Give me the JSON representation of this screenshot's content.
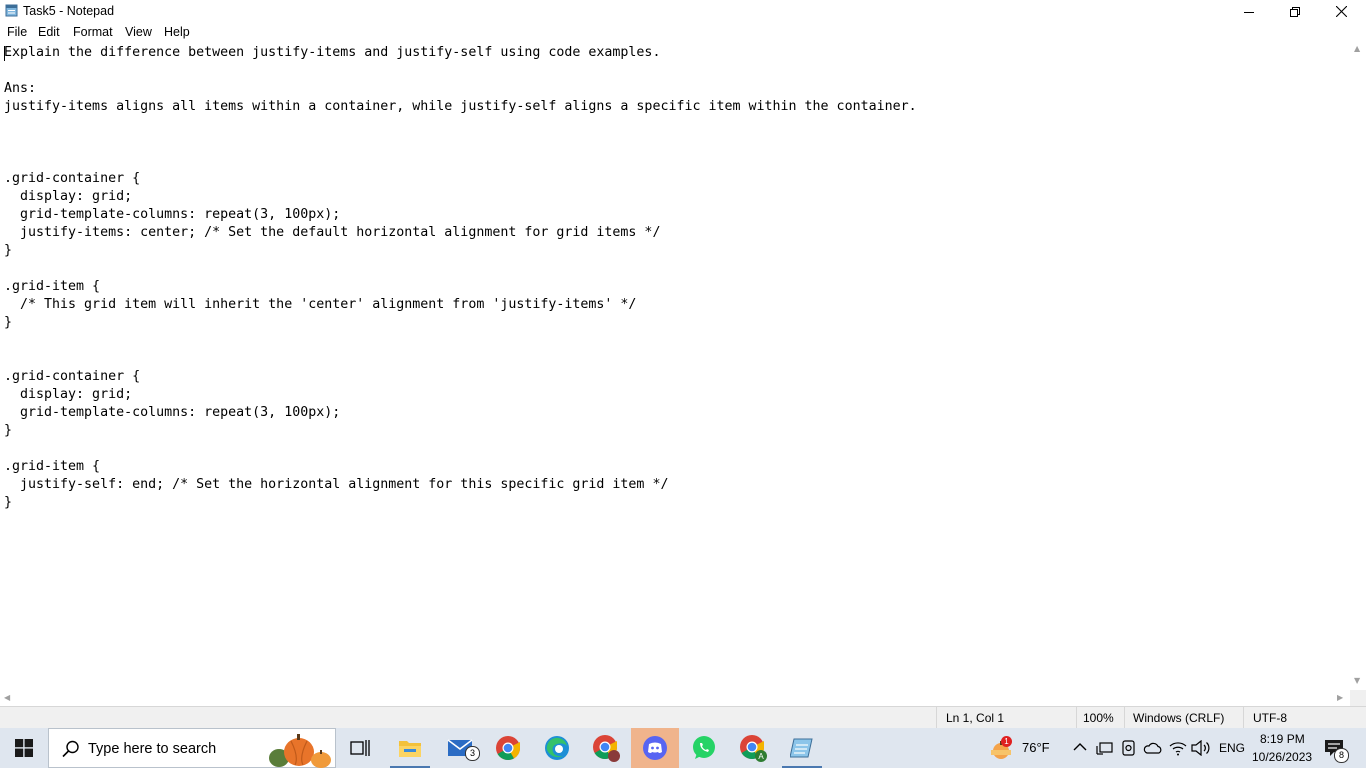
{
  "window": {
    "title": "Task5 - Notepad",
    "icon": "notepad-icon",
    "controls": {
      "minimize": "minimize-icon",
      "maximize": "restore-icon",
      "close": "close-icon"
    }
  },
  "menu": {
    "file": "File",
    "edit": "Edit",
    "format": "Format",
    "view": "View",
    "help": "Help"
  },
  "editor": {
    "content": "Explain the difference between justify-items and justify-self using code examples.\n\nAns:\njustify-items aligns all items within a container, while justify-self aligns a specific item within the container.\n\n\n\n.grid-container {\n  display: grid;\n  grid-template-columns: repeat(3, 100px);\n  justify-items: center; /* Set the default horizontal alignment for grid items */\n}\n\n.grid-item {\n  /* This grid item will inherit the 'center' alignment from 'justify-items' */\n}\n\n\n.grid-container {\n  display: grid;\n  grid-template-columns: repeat(3, 100px);\n}\n\n.grid-item {\n  justify-self: end; /* Set the horizontal alignment for this specific grid item */\n}"
  },
  "statusbar": {
    "position": "Ln 1, Col 1",
    "zoom": "100%",
    "line_ending": "Windows (CRLF)",
    "encoding": "UTF-8"
  },
  "taskbar": {
    "search_placeholder": "Type here to search",
    "apps": [
      {
        "name": "task-view-icon"
      },
      {
        "name": "file-explorer-icon"
      },
      {
        "name": "mail-icon",
        "badge": "3"
      },
      {
        "name": "chrome-icon"
      },
      {
        "name": "edge-icon"
      },
      {
        "name": "chrome-profile-icon"
      },
      {
        "name": "discord-icon"
      },
      {
        "name": "whatsapp-icon"
      },
      {
        "name": "chrome-profile-a-icon"
      },
      {
        "name": "notepad-icon"
      }
    ],
    "weather": {
      "temp": "76°F",
      "alert": "1"
    },
    "language": "ENG",
    "time": "8:19 PM",
    "date": "10/26/2023",
    "notifications": "8"
  },
  "colors": {
    "taskbar_bg": "#dfe6ef",
    "active_app_bg": "#f0b48c",
    "status_bg": "#f0f0f0"
  }
}
